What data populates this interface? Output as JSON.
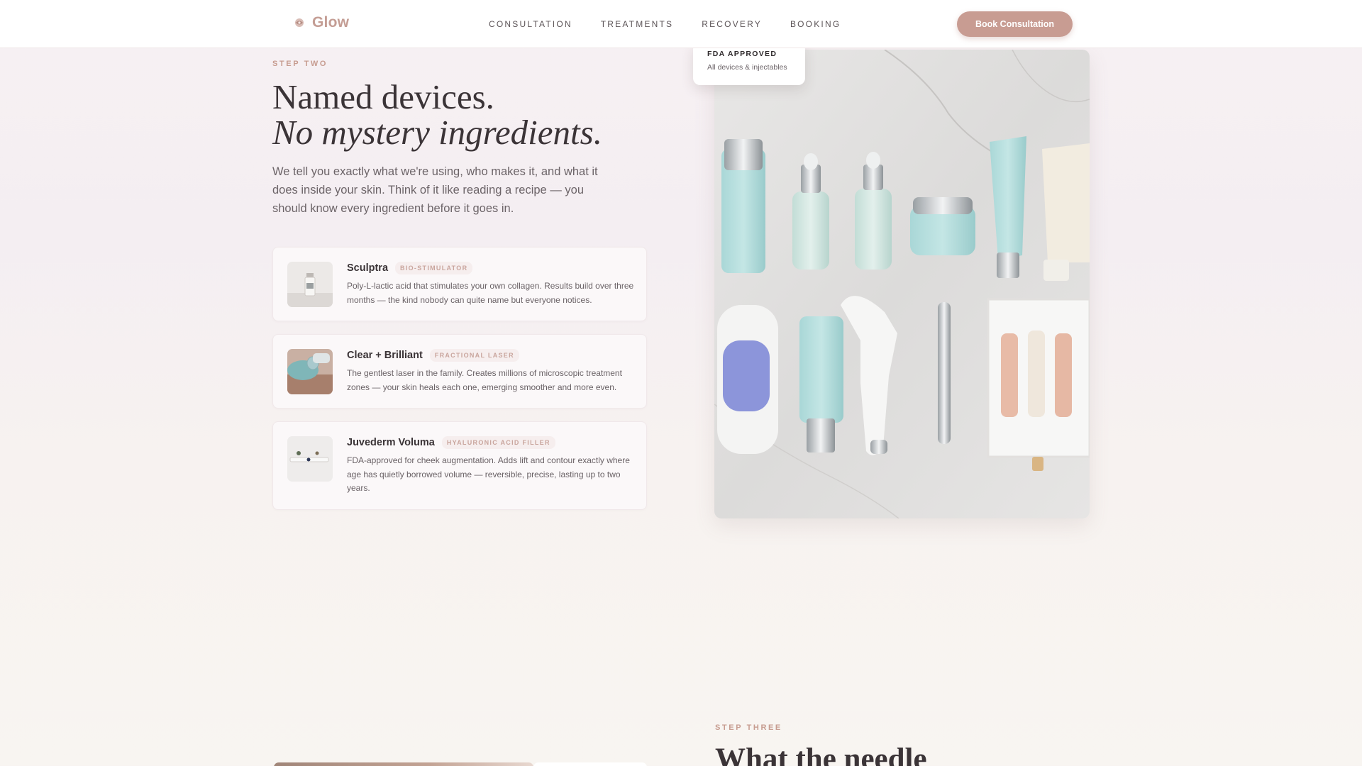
{
  "nav": {
    "brand": "Glow",
    "links": [
      "CONSULTATION",
      "TREATMENTS",
      "RECOVERY",
      "BOOKING"
    ],
    "cta": "Book Consultation"
  },
  "step_two": {
    "eyebrow": "STEP TWO",
    "headline_line1": "Named devices.",
    "headline_line2": "No mystery ingredients.",
    "intro": "We tell you exactly what we're using, who makes it, and what it does inside your skin. Think of it like reading a recipe — you should know every ingredient before it goes in."
  },
  "cards": [
    {
      "title": "Sculptra",
      "tag": "BIO-STIMULATOR",
      "description": "Poly-L-lactic acid that stimulates your own collagen. Results build over three months — the kind nobody can quite name but everyone notices."
    },
    {
      "title": "Clear + Brilliant",
      "tag": "FRACTIONAL LASER",
      "description": "The gentlest laser in the family. Creates millions of microscopic treatment zones — your skin heals each one, emerging smoother and more even."
    },
    {
      "title": "Juvederm Voluma",
      "tag": "HYALURONIC ACID FILLER",
      "description": "FDA-approved for cheek augmentation. Adds lift and contour exactly where age has quietly borrowed volume — reversible, precise, lasting up to two years."
    }
  ],
  "badge": {
    "title": "FDA APPROVED",
    "subtitle": "All devices & injectables"
  },
  "step_three": {
    "eyebrow": "STEP THREE",
    "headline": "What the needle"
  },
  "colors": {
    "accent": "#c89c92",
    "brand": "#c49d94",
    "tag_text": "#c9a59d",
    "heading": "#3b3437"
  },
  "icons": {
    "brand_mark": "glow-flower-icon"
  }
}
